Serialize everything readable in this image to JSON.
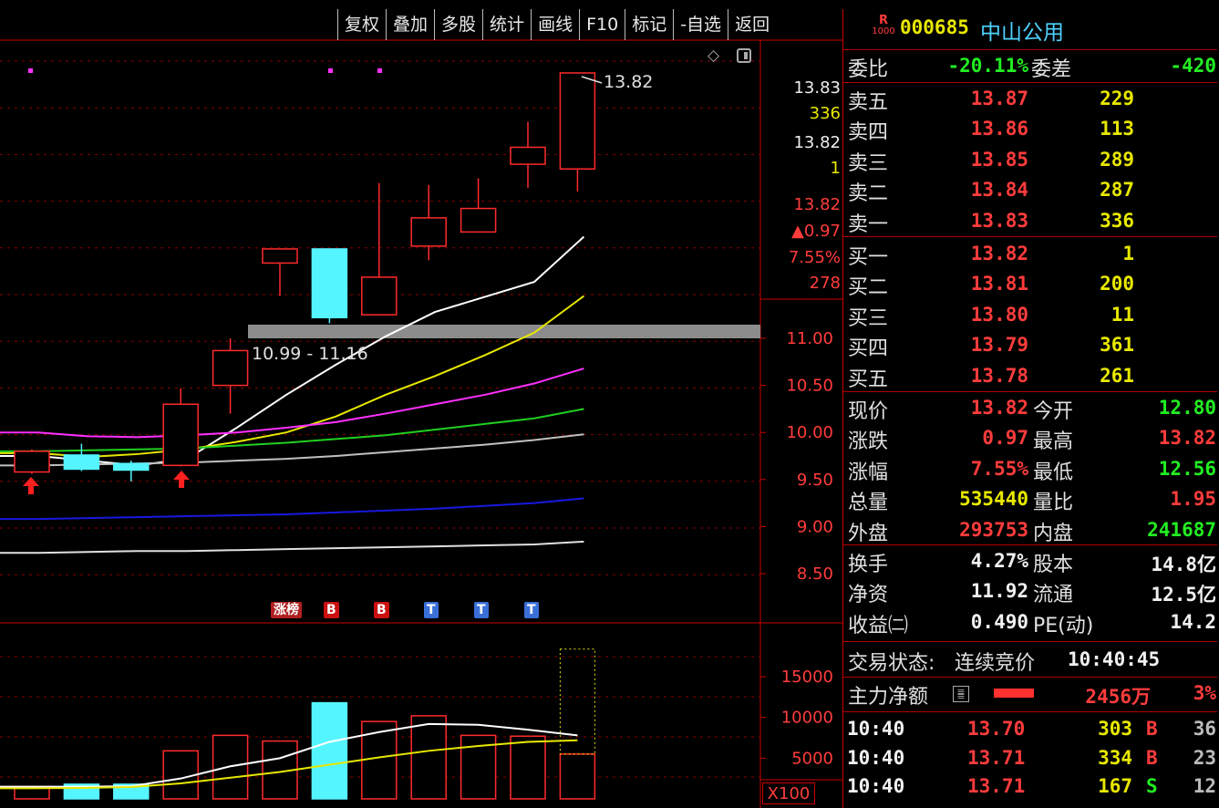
{
  "toolbar": [
    "复权",
    "叠加",
    "多股",
    "统计",
    "画线",
    "F10",
    "标记",
    "-自选",
    "返回"
  ],
  "stock": {
    "badge_top": "R",
    "badge_bottom": "1000",
    "code": "000685",
    "name": "中山公用"
  },
  "ratio": {
    "label1": "委比",
    "value1": "-20.11%",
    "label2": "委差",
    "value2": "-420"
  },
  "asks": [
    {
      "label": "卖五",
      "price": "13.87",
      "vol": "229"
    },
    {
      "label": "卖四",
      "price": "13.86",
      "vol": "113"
    },
    {
      "label": "卖三",
      "price": "13.85",
      "vol": "289"
    },
    {
      "label": "卖二",
      "price": "13.84",
      "vol": "287"
    },
    {
      "label": "卖一",
      "price": "13.83",
      "vol": "336"
    }
  ],
  "bids": [
    {
      "label": "买一",
      "price": "13.82",
      "vol": "1"
    },
    {
      "label": "买二",
      "price": "13.81",
      "vol": "200"
    },
    {
      "label": "买三",
      "price": "13.80",
      "vol": "11"
    },
    {
      "label": "买四",
      "price": "13.79",
      "vol": "361"
    },
    {
      "label": "买五",
      "price": "13.78",
      "vol": "261"
    }
  ],
  "quote": [
    {
      "l1": "现价",
      "v1": "13.82",
      "c1": "red",
      "l2": "今开",
      "v2": "12.80",
      "c2": "grn"
    },
    {
      "l1": "涨跌",
      "v1": "0.97",
      "c1": "red",
      "l2": "最高",
      "v2": "13.82",
      "c2": "red"
    },
    {
      "l1": "涨幅",
      "v1": "7.55%",
      "c1": "red",
      "l2": "最低",
      "v2": "12.56",
      "c2": "grn"
    },
    {
      "l1": "总量",
      "v1": "535440",
      "c1": "yel",
      "l2": "量比",
      "v2": "1.95",
      "c2": "red"
    },
    {
      "l1": "外盘",
      "v1": "293753",
      "c1": "red",
      "l2": "内盘",
      "v2": "241687",
      "c2": "grn"
    }
  ],
  "fund": [
    {
      "l1": "换手",
      "v1": "4.27%",
      "l2": "股本",
      "v2": "14.8亿"
    },
    {
      "l1": "净资",
      "v1": "11.92",
      "l2": "流通",
      "v2": "12.5亿"
    },
    {
      "l1": "收益㈡",
      "v1": "0.490",
      "l2": "PE(动)",
      "v2": "14.2"
    }
  ],
  "trade_status": {
    "label": "交易状态:",
    "value": "连续竞价",
    "time": "10:40:45"
  },
  "main_flow": {
    "label": "主力净额",
    "value": "2456万",
    "pct": "3%"
  },
  "ticks": [
    {
      "time": "10:40",
      "price": "13.70",
      "vol": "303",
      "side": "B",
      "num": "36"
    },
    {
      "time": "10:40",
      "price": "13.71",
      "vol": "334",
      "side": "B",
      "num": "23"
    },
    {
      "time": "10:40",
      "price": "13.71",
      "vol": "167",
      "side": "S",
      "num": "12"
    }
  ],
  "price_info": {
    "high": "13.83",
    "high_vol": "336",
    "cur": "13.82",
    "cur_vol": "1",
    "last": "13.82",
    "change": "▲0.97",
    "pct": "7.55%",
    "vol": "278"
  },
  "annotation_high": "13.82",
  "annotation_band": "10.99 - 11.16",
  "vol_unit": "X100",
  "badges": [
    {
      "text": "涨榜",
      "color": "#b02020"
    },
    {
      "text": "B",
      "color": "#cc1010"
    },
    {
      "text": "B",
      "color": "#cc1010"
    },
    {
      "text": "T",
      "color": "#3a6fd8"
    },
    {
      "text": "T",
      "color": "#3a6fd8"
    },
    {
      "text": "T",
      "color": "#3a6fd8"
    }
  ],
  "chart_data": {
    "type": "candlestick",
    "price_axis": [
      "11.00",
      "10.50",
      "10.00",
      "9.50",
      "9.00",
      "8.50"
    ],
    "price_ticks": [
      11.0,
      10.5,
      10.0,
      9.5,
      9.0,
      8.5
    ],
    "volume_axis": [
      "15000",
      "10000",
      "5000"
    ],
    "volume_ticks": [
      15000,
      10000,
      5000
    ],
    "candles": [
      {
        "o": 9.58,
        "c": 9.8,
        "h": 9.82,
        "l": 9.56
      },
      {
        "o": 9.76,
        "c": 9.61,
        "h": 9.88,
        "l": 9.59
      },
      {
        "o": 9.67,
        "c": 9.6,
        "h": 9.7,
        "l": 9.48
      },
      {
        "o": 9.65,
        "c": 10.3,
        "h": 10.47,
        "l": 9.64
      },
      {
        "o": 10.5,
        "c": 10.87,
        "h": 11.0,
        "l": 10.2
      },
      {
        "o": 11.8,
        "c": 11.95,
        "h": 11.95,
        "l": 11.45
      },
      {
        "o": 11.95,
        "c": 11.22,
        "h": 11.95,
        "l": 11.16
      },
      {
        "o": 11.25,
        "c": 11.65,
        "h": 12.65,
        "l": 11.25
      },
      {
        "o": 11.98,
        "c": 12.28,
        "h": 12.63,
        "l": 11.83
      },
      {
        "o": 12.13,
        "c": 12.38,
        "h": 12.7,
        "l": 12.13
      },
      {
        "o": 12.85,
        "c": 13.03,
        "h": 13.3,
        "l": 12.6
      },
      {
        "o": 12.8,
        "c": 13.82,
        "h": 13.82,
        "l": 12.56
      }
    ],
    "volumes": [
      1500,
      1800,
      1800,
      5900,
      7800,
      7100,
      11800,
      9500,
      10200,
      7800,
      7700,
      5500
    ],
    "ma": [
      {
        "color": "#ffffff",
        "values": [
          9.75,
          9.7,
          9.65,
          9.72,
          10.05,
          10.4,
          10.72,
          11.02,
          11.28,
          11.44,
          11.6,
          12.08
        ]
      },
      {
        "color": "#e8e800",
        "values": [
          9.78,
          9.74,
          9.77,
          9.82,
          9.9,
          10.0,
          10.17,
          10.4,
          10.6,
          10.82,
          11.06,
          11.45
        ]
      },
      {
        "color": "#ff30ff",
        "values": [
          10.0,
          9.96,
          9.95,
          9.97,
          10.0,
          10.05,
          10.11,
          10.2,
          10.3,
          10.4,
          10.52,
          10.68
        ]
      },
      {
        "color": "#20d020",
        "values": [
          9.8,
          9.81,
          9.82,
          9.83,
          9.86,
          9.89,
          9.93,
          9.97,
          10.03,
          10.09,
          10.15,
          10.25
        ]
      },
      {
        "color": "#c0c0c0",
        "values": [
          9.65,
          9.66,
          9.67,
          9.68,
          9.7,
          9.72,
          9.75,
          9.79,
          9.83,
          9.87,
          9.92,
          9.98
        ]
      },
      {
        "color": "#1818e0",
        "values": [
          9.08,
          9.09,
          9.1,
          9.11,
          9.12,
          9.13,
          9.15,
          9.17,
          9.19,
          9.22,
          9.25,
          9.3
        ]
      },
      {
        "color": "#e0e0e0",
        "values": [
          8.72,
          8.73,
          8.74,
          8.74,
          8.75,
          8.76,
          8.77,
          8.78,
          8.79,
          8.8,
          8.81,
          8.84
        ]
      }
    ],
    "vol_ma": [
      {
        "color": "#ffffff",
        "values": [
          1500,
          1500,
          1550,
          2500,
          4000,
          5000,
          7000,
          8200,
          9200,
          9100,
          8500,
          7800
        ]
      },
      {
        "color": "#e8e800",
        "values": [
          1300,
          1350,
          1450,
          1900,
          2600,
          3300,
          4200,
          5100,
          5900,
          6500,
          7000,
          7200
        ]
      }
    ]
  }
}
